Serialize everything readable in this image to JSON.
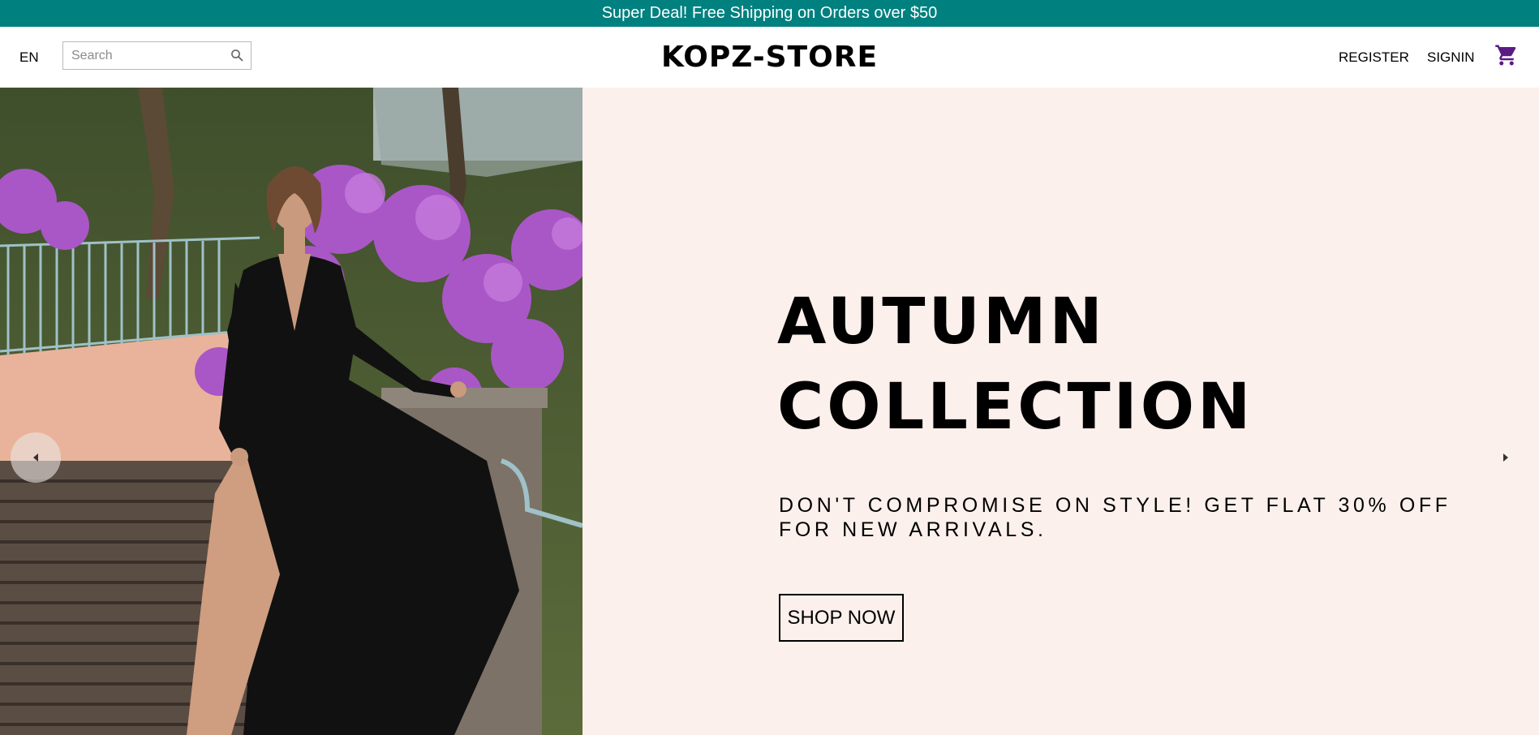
{
  "announcement": {
    "text": "Super Deal! Free Shipping on Orders over $50"
  },
  "header": {
    "language": "EN",
    "search_placeholder": "Search",
    "logo": "KOPZ-STORE",
    "register_label": "REGISTER",
    "signin_label": "SIGNIN",
    "cart_icon": "shopping-cart-icon"
  },
  "hero": {
    "title": "AUTUMN\nCOLLECTION",
    "description": "DON'T COMPROMISE ON STYLE! GET FLAT 30% OFF FOR NEW ARRIVALS.",
    "button_label": "SHOP NOW",
    "prev_icon": "arrow-left-icon",
    "next_icon": "arrow-right-icon"
  },
  "colors": {
    "announcement_bg": "#00807f",
    "hero_bg": "#fbf0ec",
    "cart_icon": "#5a1c84"
  }
}
